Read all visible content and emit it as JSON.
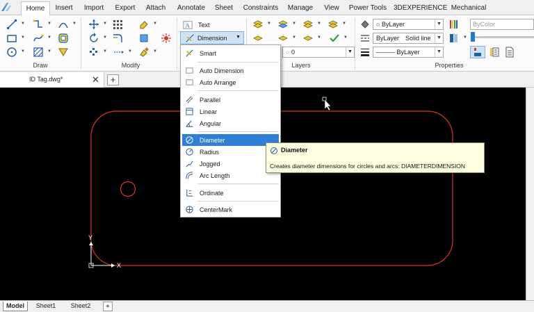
{
  "ribbon_tabs": [
    "Home",
    "Insert",
    "Import",
    "Export",
    "Attach",
    "Annotate",
    "Sheet",
    "Constraints",
    "Manage",
    "View",
    "Power Tools",
    "3DEXPERIENCE",
    "Mechanical"
  ],
  "active_tab": "Home",
  "groups": {
    "draw": "Draw",
    "modify": "Modify",
    "layers": "Layers",
    "properties": "Properties"
  },
  "annotation": {
    "text_label": "Text",
    "dimension_label": "Dimension"
  },
  "layers": {
    "current_layer": "0"
  },
  "properties": {
    "color": "ByLayer",
    "linestyle_layer": "ByLayer",
    "linestyle_value": "Solid line",
    "lineweight": "ByLayer",
    "bycolor": "ByColor"
  },
  "document": {
    "tab_name": "ID Tag.dwg*"
  },
  "layout_tabs": [
    "Model",
    "Sheet1",
    "Sheet2"
  ],
  "dimension_menu": [
    {
      "label": "Smart",
      "icon": "smart-dimension-icon"
    },
    {
      "label": "Auto Dimension",
      "icon": "auto-dimension-icon"
    },
    {
      "label": "Auto Arrange",
      "icon": "auto-arrange-icon"
    },
    {
      "label": "Parallel",
      "icon": "parallel-dimension-icon"
    },
    {
      "label": "Linear",
      "icon": "linear-dimension-icon"
    },
    {
      "label": "Angular",
      "icon": "angular-dimension-icon"
    },
    {
      "label": "Diameter",
      "icon": "diameter-dimension-icon",
      "highlighted": true
    },
    {
      "label": "Radius",
      "icon": "radius-dimension-icon"
    },
    {
      "label": "Jogged",
      "icon": "jogged-dimension-icon"
    },
    {
      "label": "Arc Length",
      "icon": "arc-length-icon"
    },
    {
      "label": "Ordinate",
      "icon": "ordinate-dimension-icon"
    },
    {
      "label": "CenterMark",
      "icon": "centermark-icon"
    }
  ],
  "tooltip": {
    "title": "Diameter",
    "description": "Creates diameter dimensions for circles and arcs:  DIAMETERDIMENSION"
  },
  "ucs": {
    "x_label": "X",
    "y_label": "Y"
  },
  "colors": {
    "accent": "#2f7fd6",
    "drawing_lines": "#e0302a",
    "canvas_bg": "#000000",
    "tooltip_bg": "#ffffe1"
  }
}
